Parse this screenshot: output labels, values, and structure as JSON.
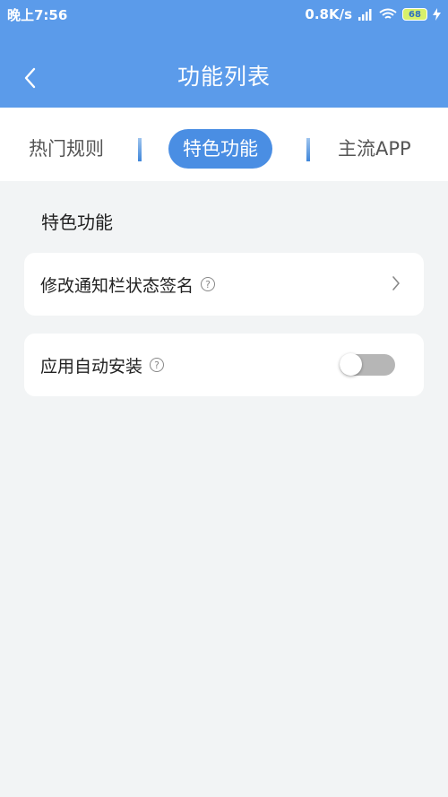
{
  "status_bar": {
    "time": "晚上7:56",
    "network_speed": "0.8K/s",
    "battery": "68"
  },
  "header": {
    "title": "功能列表"
  },
  "tabs": [
    {
      "label": "热门规则",
      "active": false
    },
    {
      "label": "特色功能",
      "active": true
    },
    {
      "label": "主流APP",
      "active": false
    }
  ],
  "section": {
    "title": "特色功能"
  },
  "items": [
    {
      "label": "修改通知栏状态签名",
      "help": "?",
      "control": "chevron-right-icon"
    },
    {
      "label": "应用自动安装",
      "help": "?",
      "control": "toggle",
      "toggle_on": false
    }
  ],
  "colors": {
    "header": "#5b9bea",
    "tab_active": "#4a8ee3",
    "background": "#f2f4f5"
  }
}
